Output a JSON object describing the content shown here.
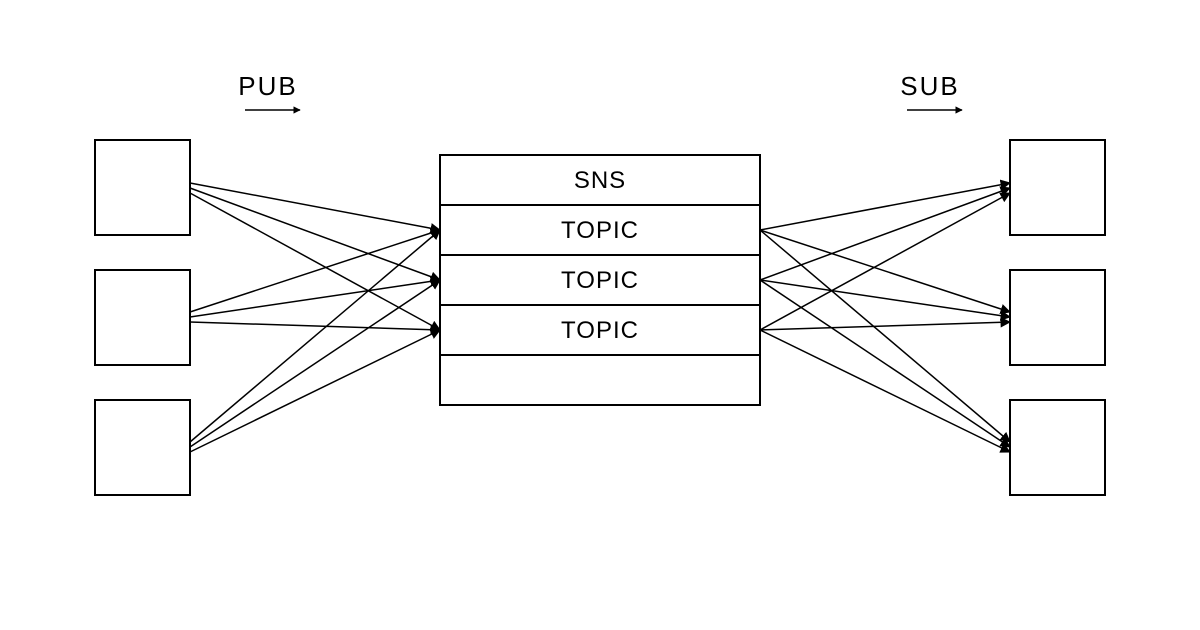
{
  "diagram": {
    "flow_left": {
      "label": "PUB"
    },
    "flow_right": {
      "label": "SUB"
    },
    "sns_header": "SNS",
    "topics": [
      "TOPIC",
      "TOPIC",
      "TOPIC"
    ],
    "publishers": 3,
    "subscribers": 3,
    "description": "Pub/Sub architecture: three publisher boxes on the left each publish to three SNS topics in the center; three subscriber boxes on the right each subscribe to all three topics."
  }
}
